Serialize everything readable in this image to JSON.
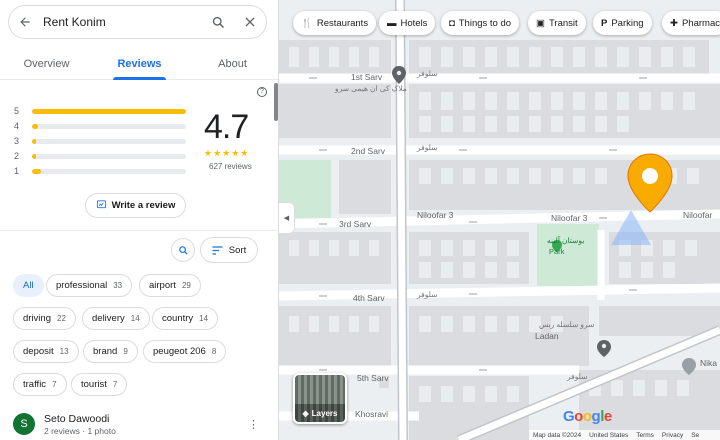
{
  "search": {
    "query": "Rent Konim"
  },
  "tabs": [
    "Overview",
    "Reviews",
    "About"
  ],
  "rating": {
    "bars": [
      {
        "label": "5",
        "fraction": 1.0
      },
      {
        "label": "4",
        "fraction": 0.04
      },
      {
        "label": "3",
        "fraction": 0.015
      },
      {
        "label": "2",
        "fraction": 0.01
      },
      {
        "label": "1",
        "fraction": 0.06
      }
    ],
    "average": "4.7",
    "stars": "★★★★★",
    "count": "627 reviews"
  },
  "write_review": "Write a review",
  "sort_label": "Sort",
  "chips": [
    {
      "label": "All",
      "count": ""
    },
    {
      "label": "professional",
      "count": "33"
    },
    {
      "label": "airport",
      "count": "29"
    },
    {
      "label": "driving",
      "count": "22"
    },
    {
      "label": "delivery",
      "count": "14"
    },
    {
      "label": "country",
      "count": "14"
    },
    {
      "label": "deposit",
      "count": "13"
    },
    {
      "label": "brand",
      "count": "9"
    },
    {
      "label": "peugeot 206",
      "count": "8"
    },
    {
      "label": "traffic",
      "count": "7"
    },
    {
      "label": "tourist",
      "count": "7"
    }
  ],
  "review": {
    "avatar": "S",
    "name": "Seto Dawoodi",
    "meta": "2 reviews · 1 photo"
  },
  "categories": [
    "Restaurants",
    "Hotels",
    "Things to do",
    "Transit",
    "Parking",
    "Pharmac"
  ],
  "map_labels": {
    "sarv1": "1st Sarv",
    "sarv2": "2nd Sarv",
    "sarv3": "3rd Sarv",
    "sarv4": "4th Sarv",
    "sarv5": "5th Sarv",
    "niloofar_a": "Niloofar 3",
    "niloofar_b": "Niloofar 3",
    "niloofar_c": "Niloofar",
    "park": "Park",
    "ladan": "Ladan",
    "khosravi": "Khosravi",
    "nika": "Nika",
    "fa_1": "سلوفر",
    "fa_2": "ملاک کی ان هیمی سرو",
    "fa_3": "سلوفر",
    "fa_4": "بوستان آلینه",
    "fa_5": "سلوفر",
    "fa_6": "سرو سلسله ربس",
    "fa_7": "سلوفر"
  },
  "layers_label": "Layers",
  "google": [
    "G",
    "o",
    "o",
    "g",
    "l",
    "e"
  ],
  "footer": [
    "Map data ©2024",
    "United States",
    "Terms",
    "Privacy",
    "Se"
  ],
  "colors": {
    "accent": "#1a73e8",
    "star": "#fbbc04",
    "pin": "#f9ab00",
    "park": "#ceead6"
  }
}
